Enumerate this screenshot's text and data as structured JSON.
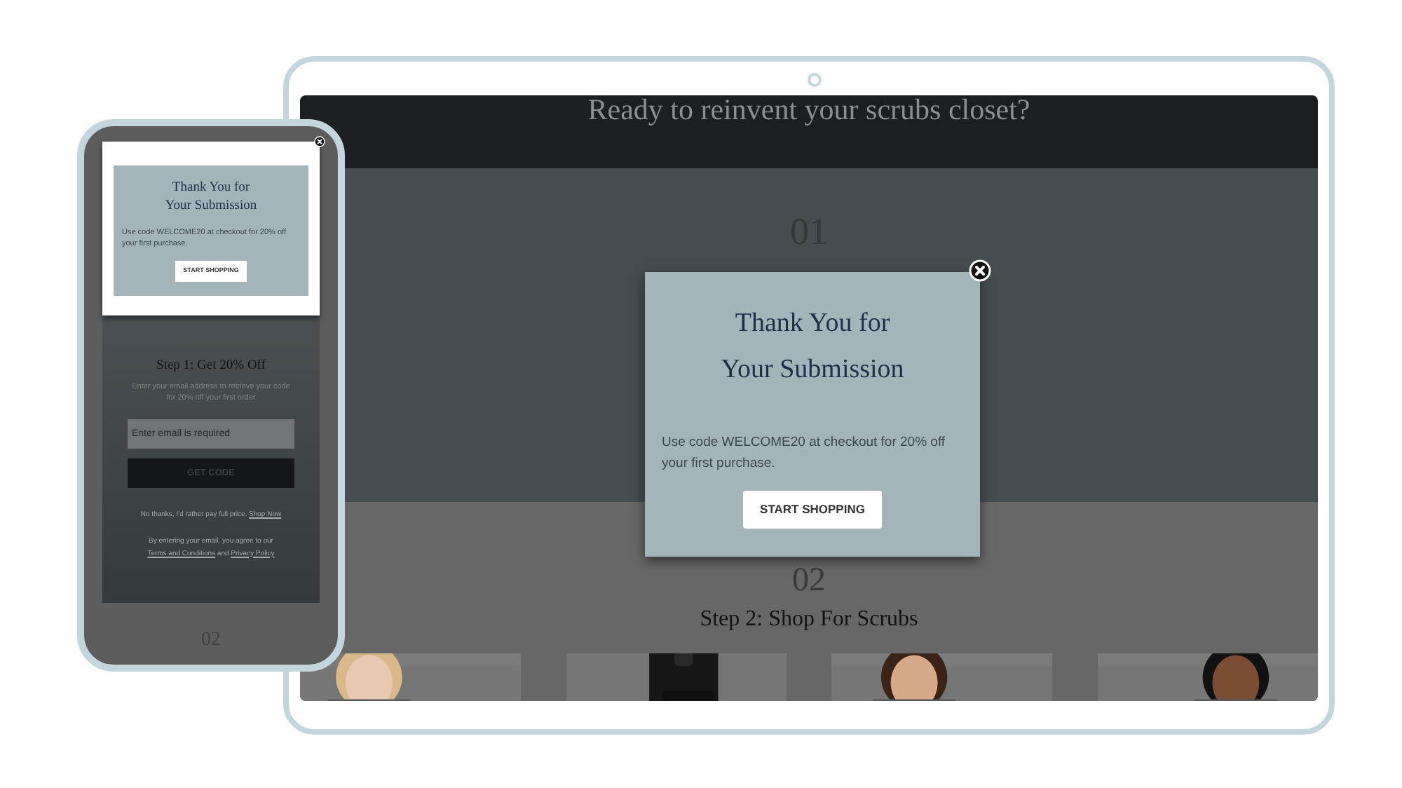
{
  "tablet": {
    "header": {
      "title": "Ready to reinvent your scrubs closet?"
    },
    "step1": {
      "number": "01"
    },
    "step2": {
      "number": "02",
      "title": "Step 2: Shop For Scrubs"
    },
    "modal": {
      "title_lines": [
        "Thank You for",
        "Your Submission"
      ],
      "message": "Use code WELCOME20 at checkout for 20% off your first purchase.",
      "button": "START SHOPPING"
    }
  },
  "phone": {
    "modal": {
      "title_lines": [
        "Thank You for",
        "Your Submission"
      ],
      "message": "Use code WELCOME20 at checkout for 20% off your first purchase.",
      "button": "START SHOPPING"
    },
    "step1": {
      "title": "Step 1: Get 20% Off",
      "description": "Enter your email address to retrieve your code for 20% off your first order",
      "email": {
        "placeholder": "Enter email is required"
      },
      "button": "GET CODE",
      "decline": {
        "text": "No thanks, I'd rather pay full price.",
        "link": "Shop Now"
      },
      "legal": {
        "text": "By entering your email, you agree to our",
        "link1": "Terms and Conditions",
        "joiner": "and",
        "link2": "Privacy Policy"
      }
    },
    "step2": {
      "number": "02"
    }
  }
}
